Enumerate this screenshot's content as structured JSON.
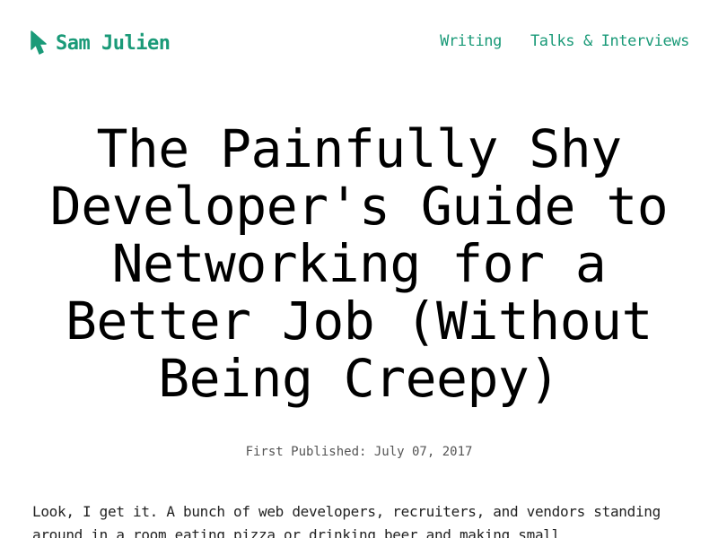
{
  "site": {
    "brand_name": "Sam Julien",
    "logo_icon": "cursor-arrow-icon",
    "accent_color": "#1a9a78"
  },
  "nav": {
    "items": [
      {
        "label": "Writing"
      },
      {
        "label": "Talks & Interviews"
      }
    ]
  },
  "post": {
    "title": "The Painfully Shy Developer's Guide to Networking for a Better Job (Without Being Creepy)",
    "published_label": "First Published:",
    "published_date": "July 07, 2017",
    "intro": "Look, I get it. A bunch of web developers, recruiters, and vendors standing around in a room eating pizza or drinking beer and making small"
  }
}
